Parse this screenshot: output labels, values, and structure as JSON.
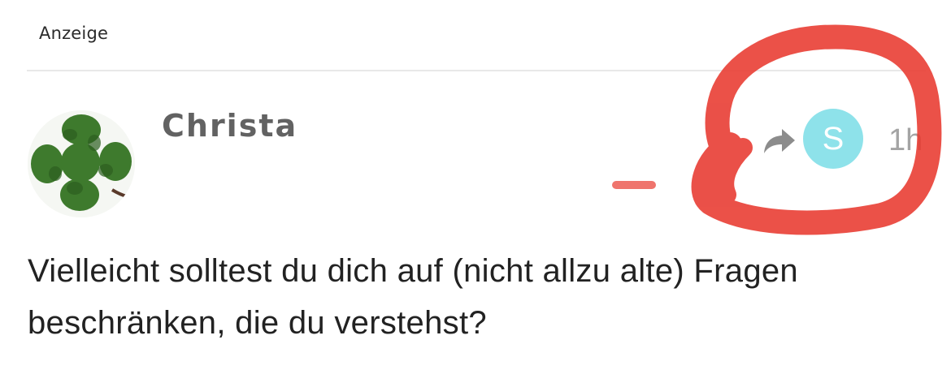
{
  "ad": {
    "label": "Anzeige"
  },
  "comment": {
    "author": "Christa",
    "avatar_icon": "four-leaf-clover-icon",
    "share_icon": "share-icon",
    "user_badge": {
      "letter": "S",
      "color": "#8ee2ea"
    },
    "timestamp": "1h",
    "text": "Vielleicht solltest du dich auf (nicht allzu alte) Fragen beschränken, die du verstehst?"
  },
  "annotation": {
    "color": "#e8392f",
    "shape": "freehand-circle"
  }
}
